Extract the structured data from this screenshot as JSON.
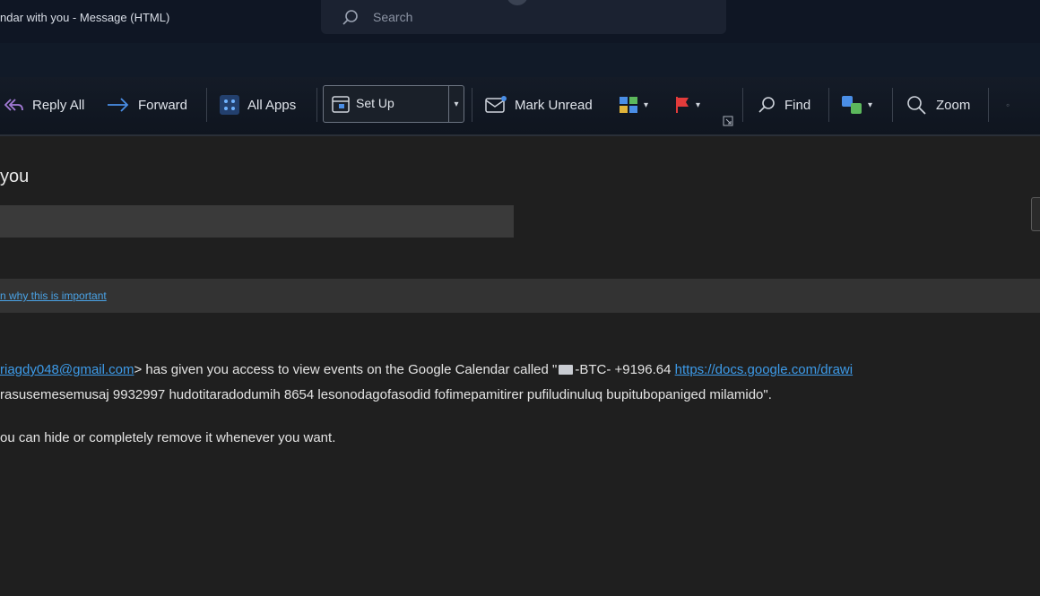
{
  "window": {
    "title": "ndar with you  -  Message (HTML)"
  },
  "search": {
    "placeholder": "Search"
  },
  "ribbon": {
    "reply_all": "Reply All",
    "forward": "Forward",
    "all_apps": "All Apps",
    "setup": "Set Up",
    "mark_unread": "Mark Unread",
    "find": "Find",
    "zoom": "Zoom"
  },
  "message": {
    "subject": "you",
    "info_link": "n why this is important",
    "sender_email": "riagdy048@gmail.com",
    "line1_text": "> has given you access to view events on the Google Calendar called \"",
    "line1_suffix": "-BTC- +9196.64 ",
    "line1_link": "https://docs.google.com/drawi",
    "line2": "rasusemesemusaj 9932997 hudotitaradodumih 8654 lesonodagofasodid fofimepamitirer pufiludinuluq bupitubopaniged milamido\".",
    "line3": "ou can hide or completely remove it whenever you want."
  },
  "colors": {
    "link": "#3d9be9",
    "accent_flag": "#e23b3b"
  },
  "icons": [
    "search-icon",
    "reply-all-icon",
    "forward-icon",
    "apps-icon",
    "calendar-icon",
    "mail-unread-icon",
    "categorize-icon",
    "flag-icon",
    "expand-icon",
    "find-icon",
    "translate-icon",
    "zoom-icon"
  ]
}
